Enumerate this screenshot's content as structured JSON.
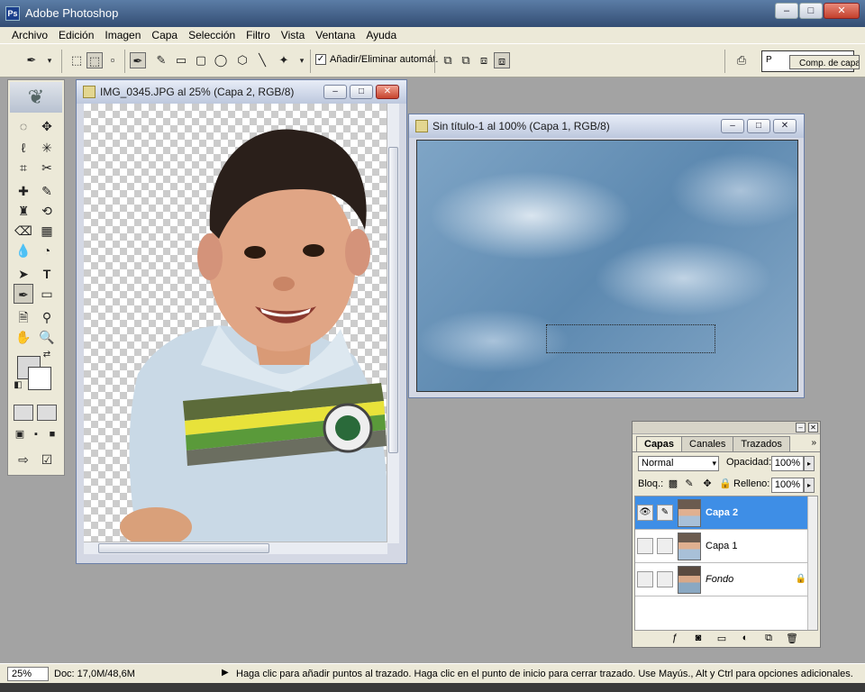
{
  "app": {
    "title": "Adobe Photoshop",
    "icon": "photoshop-app-icon"
  },
  "window_buttons": {
    "minimize": "–",
    "maximize": "□",
    "close": "✕"
  },
  "menu": [
    "Archivo",
    "Edición",
    "Imagen",
    "Capa",
    "Selección",
    "Filtro",
    "Vista",
    "Ventana",
    "Ayuda"
  ],
  "options": {
    "auto_add_delete_checked": true,
    "auto_add_delete_label": "Añadir/Eliminar automát.",
    "palette_well_tab": "Comp. de capa",
    "palette_well_prefix": "P"
  },
  "toolbox": {
    "foreground": "#d8d8d8",
    "background": "#ffffff"
  },
  "doc1": {
    "title": "IMG_0345.JPG al 25% (Capa 2, RGB/8)"
  },
  "doc2": {
    "title": "Sin título-1 al 100% (Capa 1, RGB/8)"
  },
  "layers_panel": {
    "tabs": [
      "Capas",
      "Canales",
      "Trazados"
    ],
    "blend_mode": "Normal",
    "opacity_label": "Opacidad:",
    "opacity_value": "100%",
    "lock_label": "Bloq.:",
    "fill_label": "Relleno:",
    "fill_value": "100%",
    "layers": [
      {
        "name": "Capa 2",
        "selected": true,
        "visible": true
      },
      {
        "name": "Capa 1",
        "selected": false,
        "visible": false
      },
      {
        "name": "Fondo",
        "selected": false,
        "visible": false,
        "locked": true
      }
    ]
  },
  "status": {
    "zoom": "25%",
    "doc_size": "Doc: 17,0M/48,6M",
    "hint": "Haga clic para añadir puntos al trazado. Haga clic en el punto de inicio para cerrar trazado. Use Mayús., Alt y Ctrl para opciones adicionales."
  },
  "colors": {
    "selection": "#3e8ee6",
    "ui_bg": "#ece9d8",
    "workspace": "#a3a3a3"
  }
}
